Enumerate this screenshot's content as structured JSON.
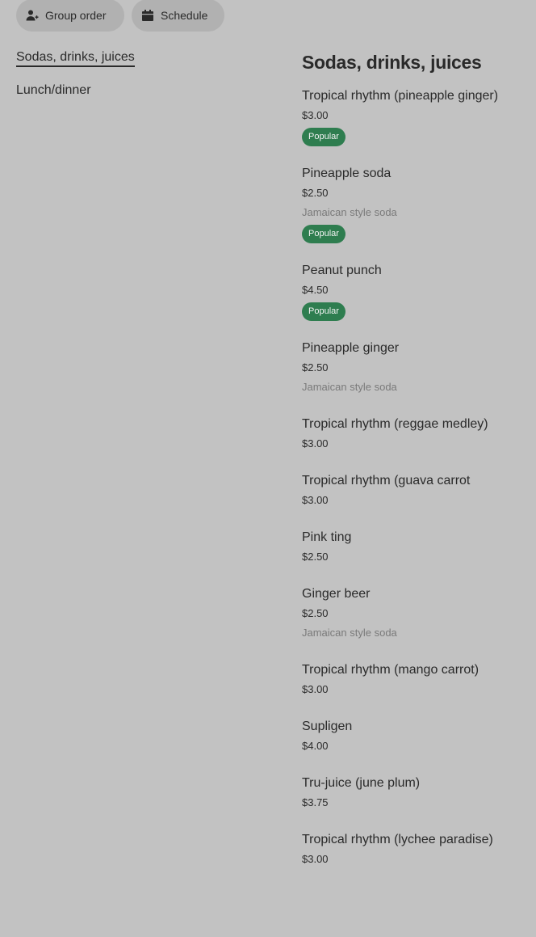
{
  "top_buttons": {
    "group_order": "Group order",
    "schedule": "Schedule"
  },
  "sidebar": {
    "items": [
      {
        "label": "Sodas, drinks, juices"
      },
      {
        "label": "Lunch/dinner"
      }
    ]
  },
  "section": {
    "title": "Sodas, drinks, juices",
    "items": [
      {
        "name": "Tropical rhythm (pineapple ginger)",
        "price": "$3.00",
        "desc": "",
        "badge": "Popular"
      },
      {
        "name": "Pineapple soda",
        "price": "$2.50",
        "desc": "Jamaican style soda",
        "badge": "Popular"
      },
      {
        "name": "Peanut punch",
        "price": "$4.50",
        "desc": "",
        "badge": "Popular"
      },
      {
        "name": "Pineapple ginger",
        "price": "$2.50",
        "desc": "Jamaican style soda",
        "badge": ""
      },
      {
        "name": "Tropical rhythm (reggae medley)",
        "price": "$3.00",
        "desc": "",
        "badge": ""
      },
      {
        "name": "Tropical rhythm (guava carrot",
        "price": "$3.00",
        "desc": "",
        "badge": ""
      },
      {
        "name": "Pink ting",
        "price": "$2.50",
        "desc": "",
        "badge": ""
      },
      {
        "name": "Ginger beer",
        "price": "$2.50",
        "desc": "Jamaican style soda",
        "badge": ""
      },
      {
        "name": "Tropical rhythm (mango carrot)",
        "price": "$3.00",
        "desc": "",
        "badge": ""
      },
      {
        "name": "Supligen",
        "price": "$4.00",
        "desc": "",
        "badge": ""
      },
      {
        "name": "Tru-juice (june plum)",
        "price": "$3.75",
        "desc": "",
        "badge": ""
      },
      {
        "name": "Tropical rhythm (lychee paradise)",
        "price": "$3.00",
        "desc": "",
        "badge": ""
      }
    ]
  },
  "colors": {
    "background": "#c2c2c2",
    "pill": "#b1b1b1",
    "badge": "#2e7d4f"
  }
}
